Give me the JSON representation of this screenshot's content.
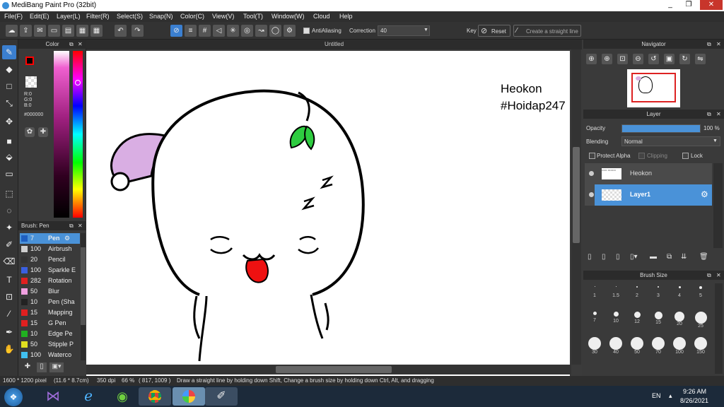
{
  "window": {
    "title": "MediBang Paint Pro (32bit)",
    "minimize": "_",
    "restore": "❐",
    "close": "✕"
  },
  "menu": [
    "File(F)",
    "Edit(E)",
    "Layer(L)",
    "Filter(R)",
    "Select(S)",
    "Snap(N)",
    "Color(C)",
    "View(V)",
    "Tool(T)",
    "Window(W)",
    "Cloud",
    "Help"
  ],
  "toolbar": {
    "antialiasing": "AntiAliasing",
    "correction_label": "Correction",
    "correction_value": "40",
    "key_label": "Key",
    "reset_label": "Reset",
    "straight_line_label": "Create a straight line"
  },
  "color_panel": {
    "title": "Color",
    "r": "R:0",
    "g": "G:0",
    "b": "B:0",
    "hex": "#000000",
    "fg_color": "#000000",
    "fg_border": "#ff0000"
  },
  "brush_panel": {
    "title": "Brush: Pen",
    "brushes": [
      {
        "size": "7",
        "name": "Pen",
        "color": "#1e5fc0"
      },
      {
        "size": "100",
        "name": "Airbrush",
        "color": "#cfcfcf"
      },
      {
        "size": "20",
        "name": "Pencil",
        "color": "#333333"
      },
      {
        "size": "100",
        "name": "Sparkle E",
        "color": "#3a5fe0"
      },
      {
        "size": "282",
        "name": "Rotation",
        "color": "#e02020"
      },
      {
        "size": "50",
        "name": "Blur",
        "color": "#f0a0e0"
      },
      {
        "size": "10",
        "name": "Pen (Sha",
        "color": "#222222"
      },
      {
        "size": "15",
        "name": "Mapping",
        "color": "#e02020"
      },
      {
        "size": "15",
        "name": "G Pen",
        "color": "#e02020"
      },
      {
        "size": "10",
        "name": "Edge Pe",
        "color": "#20b020"
      },
      {
        "size": "50",
        "name": "Stipple P",
        "color": "#e0e020"
      },
      {
        "size": "100",
        "name": "Waterco",
        "color": "#40c0f0"
      }
    ]
  },
  "canvas": {
    "tab_title": "Untitled",
    "text_line1": "Heokon",
    "text_line2": "#Hoidap247",
    "hat_color": "#d9aee3",
    "leaf_color": "#2ecc40",
    "tongue_color": "#ee1111"
  },
  "navigator": {
    "title": "Navigator"
  },
  "layer_panel": {
    "title": "Layer",
    "opacity_label": "Opacity",
    "opacity_value": "100 %",
    "opacity_fraction": 1.0,
    "blending_label": "Blending",
    "blending_value": "Normal",
    "protect_alpha": "Protect Alpha",
    "clipping": "Clipping",
    "lock": "Lock",
    "layers": [
      {
        "name": "Heokon"
      },
      {
        "name": "Layer1"
      }
    ]
  },
  "brush_size_panel": {
    "title": "Brush Size",
    "sizes": [
      "1",
      "1.5",
      "2",
      "3",
      "4",
      "5",
      "7",
      "10",
      "12",
      "15",
      "20",
      "25",
      "30",
      "40",
      "50",
      "70",
      "100",
      "150"
    ]
  },
  "status": {
    "dimensions": "1600 * 1200 pixel",
    "physical": "(11.6 * 8.7cm)",
    "dpi": "350 dpi",
    "zoom": "66 %",
    "coords": "( 817, 1009 )",
    "hint": "Draw a straight line by holding down Shift, Change a brush size by holding down Ctrl, Alt, and dragging"
  },
  "taskbar": {
    "lang": "EN",
    "time": "9:26 AM",
    "date": "8/26/2021"
  }
}
